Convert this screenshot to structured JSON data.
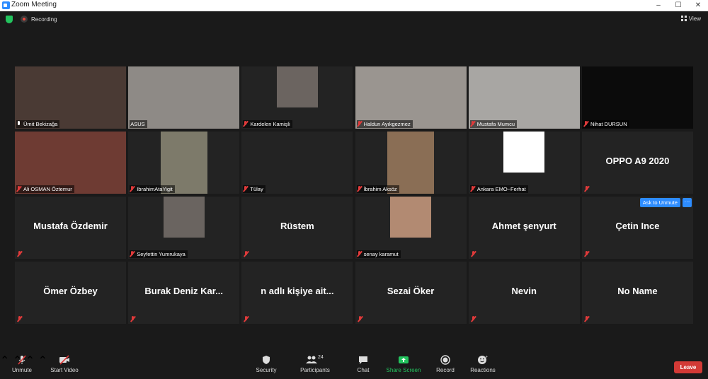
{
  "window": {
    "title": "Zoom Meeting",
    "controls": [
      "–",
      "☐",
      "✕"
    ]
  },
  "topbar": {
    "recording_label": "Recording",
    "view_label": "View"
  },
  "participants": [
    {
      "name": "Ümit Bekizağa",
      "type": "video",
      "active": true,
      "mic": "live",
      "bg": "#4a3a34"
    },
    {
      "name": "ASUS",
      "type": "video",
      "mic": "none",
      "bg": "#8e8a86"
    },
    {
      "name": "Kardelen Kamişli",
      "type": "photo",
      "mic": "muted",
      "bg": "#6b6460"
    },
    {
      "name": "Haldun Ayıkgezmez",
      "type": "video",
      "mic": "muted",
      "bg": "#9a9590"
    },
    {
      "name": "Mustafa Mumcu",
      "type": "video",
      "mic": "muted",
      "bg": "#a8a6a3"
    },
    {
      "name": "Nihat DURSUN",
      "type": "video",
      "mic": "muted",
      "bg": "#0b0b0b"
    },
    {
      "name": "Ali OSMAN Öztemur",
      "type": "video",
      "mic": "muted",
      "bg": "#6e3b33"
    },
    {
      "name": "IbrahimAtaYigit",
      "type": "photo",
      "mic": "muted",
      "bg": "#7d7a6a"
    },
    {
      "name": "Tülay",
      "type": "blank",
      "mic": "muted"
    },
    {
      "name": "İbrahim Aksöz",
      "type": "photo",
      "mic": "muted",
      "bg": "#8a6e55"
    },
    {
      "name": "Ankara EMO~Ferhat",
      "type": "photo",
      "mic": "muted",
      "bg": "#ffffff"
    },
    {
      "name": "",
      "big": "OPPO A9 2020",
      "type": "name",
      "mic": "muted"
    },
    {
      "name": "",
      "big": "Mustafa Özdemir",
      "type": "name",
      "mic": "muted"
    },
    {
      "name": "Seyfettin Yumrukaya",
      "type": "photo",
      "mic": "muted",
      "bg": "#6a6460"
    },
    {
      "name": "",
      "big": "Rüstem",
      "type": "name",
      "mic": "muted"
    },
    {
      "name": "senay karamut",
      "type": "photo",
      "mic": "muted",
      "bg": "#b28a72"
    },
    {
      "name": "",
      "big": "Ahmet şenyurt",
      "type": "name",
      "mic": "muted"
    },
    {
      "name": "",
      "big": "Çetin Ince",
      "type": "name",
      "mic": "muted",
      "hover": true
    },
    {
      "name": "",
      "big": "Ömer Özbey",
      "type": "name",
      "mic": "muted"
    },
    {
      "name": "",
      "big": "Burak Deniz Kar...",
      "type": "name",
      "mic": "muted"
    },
    {
      "name": "",
      "big": "n adlı kişiye ait...",
      "type": "name",
      "mic": "muted"
    },
    {
      "name": "",
      "big": "Sezai Öker",
      "type": "name",
      "mic": "muted"
    },
    {
      "name": "",
      "big": "Nevin",
      "type": "name",
      "mic": "muted"
    },
    {
      "name": "",
      "big": "No Name",
      "type": "name",
      "mic": "muted"
    }
  ],
  "hover_actions": {
    "ask_unmute": "Ask to Unmute",
    "more": "···"
  },
  "toolbar": {
    "unmute": "Unmute",
    "start_video": "Start Video",
    "security": "Security",
    "participants": "Participants",
    "participants_count": "24",
    "chat": "Chat",
    "share_screen": "Share Screen",
    "record": "Record",
    "reactions": "Reactions",
    "leave": "Leave"
  },
  "colors": {
    "accent": "#2d8cff",
    "share": "#23c45e",
    "leave": "#d33a36",
    "active_outline": "#d7e87c",
    "muted": "#e03a3a"
  }
}
